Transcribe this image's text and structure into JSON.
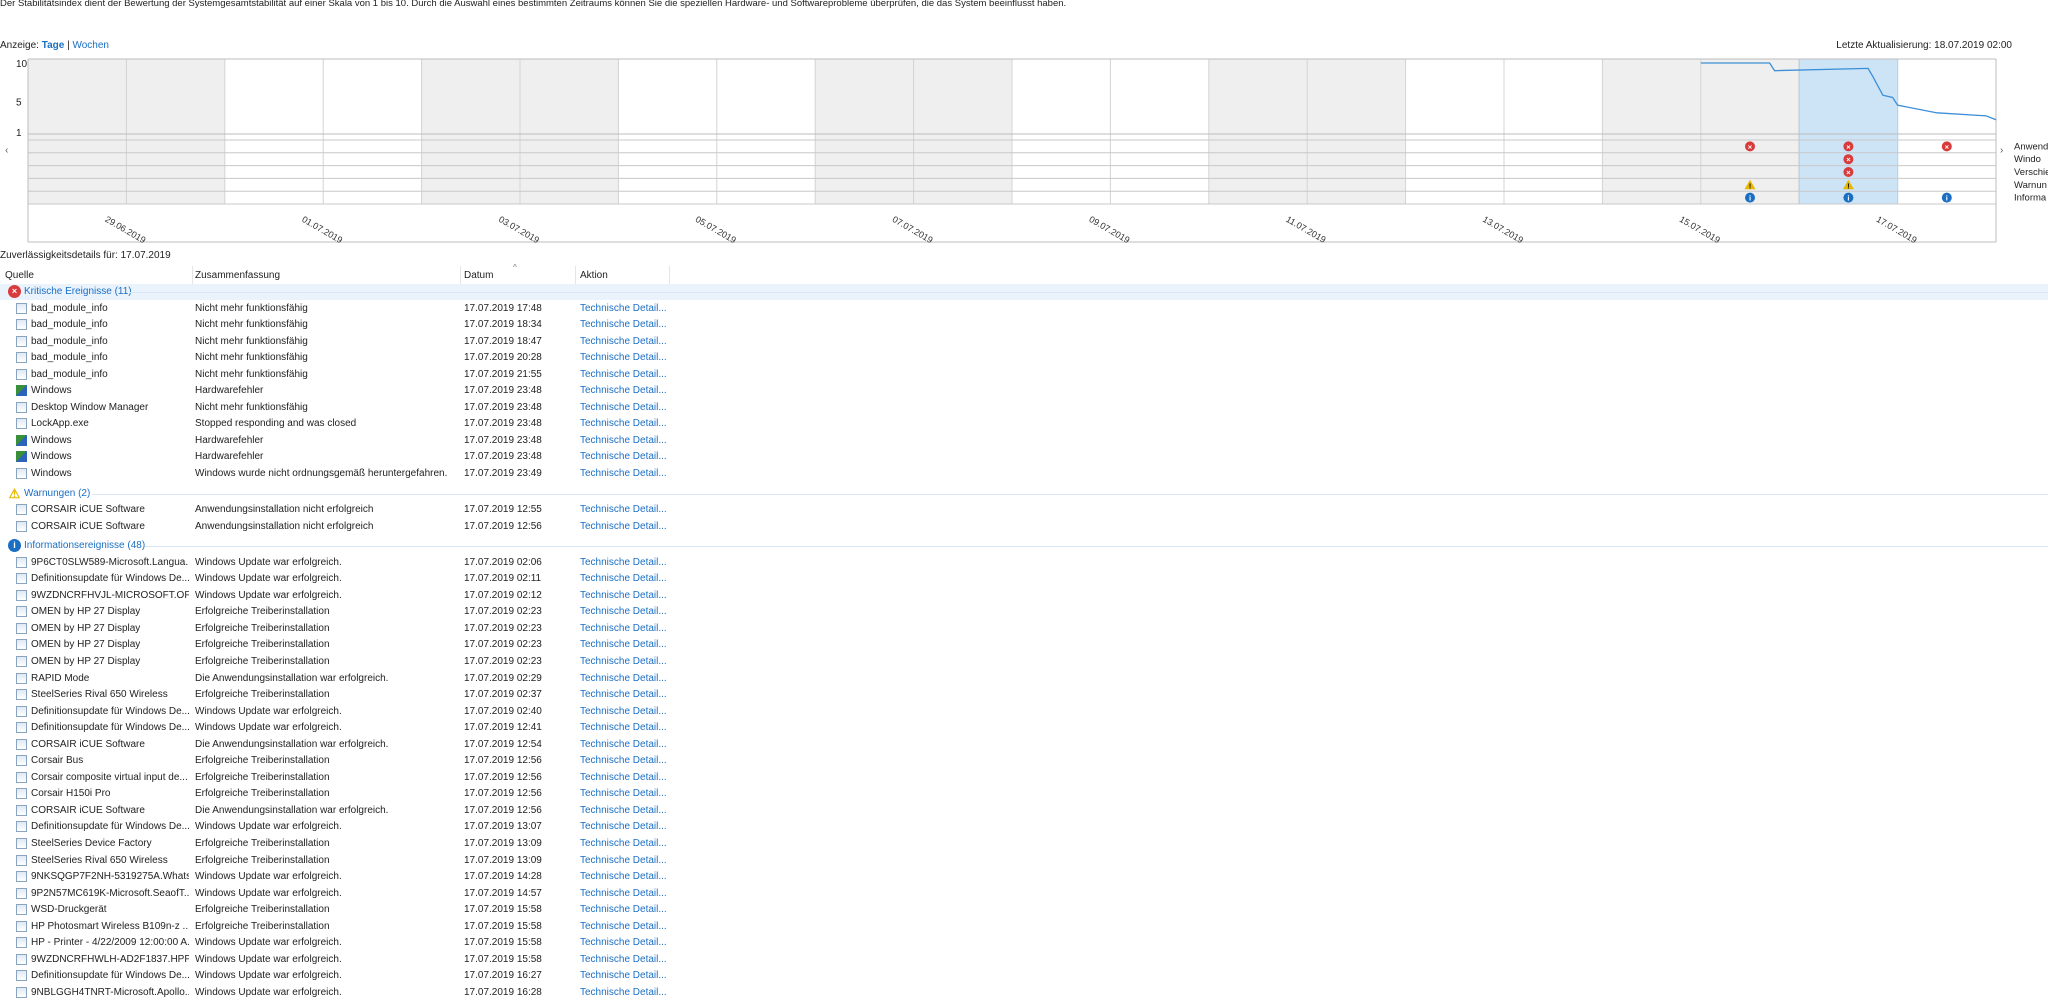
{
  "intro": "Der Stabilitätsindex dient der Bewertung der Systemgesamtstabilität auf einer Skala von 1 bis 10. Durch die Auswahl eines bestimmten Zeitraums können Sie die speziellen Hardware- und Softwareprobleme überprüfen, die das System beeinflusst haben.",
  "view": {
    "label": "Anzeige:",
    "days": "Tage",
    "sep": "|",
    "weeks": "Wochen"
  },
  "last_update": "Letzte Aktualisierung: 18.07.2019 02:00",
  "chart_data": {
    "type": "line",
    "y_ticks": [
      "10",
      "5",
      "1"
    ],
    "ylim": [
      1,
      10
    ],
    "columns": 20,
    "x_labels": [
      "29.06.2019",
      "01.07.2019",
      "03.07.2019",
      "05.07.2019",
      "07.07.2019",
      "09.07.2019",
      "11.07.2019",
      "13.07.2019",
      "15.07.2019",
      "17.07.2019"
    ],
    "selected_column": 18,
    "stability_line": [
      [
        17.0,
        10.0
      ],
      [
        17.7,
        10.0
      ],
      [
        17.75,
        9.0
      ],
      [
        18.7,
        9.3
      ],
      [
        18.75,
        8.2
      ],
      [
        18.85,
        5.8
      ],
      [
        18.95,
        5.5
      ],
      [
        19.0,
        4.5
      ],
      [
        19.4,
        3.5
      ],
      [
        19.9,
        3.1
      ],
      [
        20,
        2.6
      ]
    ],
    "rows": [
      "Anwendungsfehler",
      "Windows-Fehler",
      "Verschiedene Fehler",
      "Warnungen",
      "Informationen"
    ],
    "events": [
      {
        "row": 0,
        "col": 17,
        "kind": "error"
      },
      {
        "row": 0,
        "col": 18,
        "kind": "error"
      },
      {
        "row": 0,
        "col": 19,
        "kind": "error"
      },
      {
        "row": 1,
        "col": 18,
        "kind": "error"
      },
      {
        "row": 2,
        "col": 18,
        "kind": "error"
      },
      {
        "row": 3,
        "col": 17,
        "kind": "warn"
      },
      {
        "row": 3,
        "col": 18,
        "kind": "warn"
      },
      {
        "row": 4,
        "col": 17,
        "kind": "info"
      },
      {
        "row": 4,
        "col": 18,
        "kind": "info"
      },
      {
        "row": 4,
        "col": 19,
        "kind": "info"
      }
    ],
    "right_labels": [
      "Anwend",
      "Windo",
      "Verschie",
      "Warnun",
      "Informa"
    ]
  },
  "details_title": "Zuverlässigkeitsdetails für: 17.07.2019",
  "columns": {
    "source": "Quelle",
    "summary": "Zusammenfassung",
    "date": "Datum",
    "action": "Aktion"
  },
  "groups": [
    {
      "label": "Kritische Ereignisse (11)",
      "icon": "error",
      "rows": [
        [
          "bad_module_info",
          "Nicht mehr funktionsfähig",
          "17.07.2019 17:48",
          "Technische Detail..."
        ],
        [
          "bad_module_info",
          "Nicht mehr funktionsfähig",
          "17.07.2019 18:34",
          "Technische Detail..."
        ],
        [
          "bad_module_info",
          "Nicht mehr funktionsfähig",
          "17.07.2019 18:47",
          "Technische Detail..."
        ],
        [
          "bad_module_info",
          "Nicht mehr funktionsfähig",
          "17.07.2019 20:28",
          "Technische Detail..."
        ],
        [
          "bad_module_info",
          "Nicht mehr funktionsfähig",
          "17.07.2019 21:55",
          "Technische Detail..."
        ],
        [
          "Windows",
          "Hardwarefehler",
          "17.07.2019 23:48",
          "Technische Detail..."
        ],
        [
          "Desktop Window Manager",
          "Nicht mehr funktionsfähig",
          "17.07.2019 23:48",
          "Technische Detail..."
        ],
        [
          "LockApp.exe",
          "Stopped responding and was closed",
          "17.07.2019 23:48",
          "Technische Detail..."
        ],
        [
          "Windows",
          "Hardwarefehler",
          "17.07.2019 23:48",
          "Technische Detail..."
        ],
        [
          "Windows",
          "Hardwarefehler",
          "17.07.2019 23:48",
          "Technische Detail..."
        ],
        [
          "Windows",
          "Windows wurde nicht ordnungsgemäß heruntergefahren.",
          "17.07.2019 23:49",
          "Technische Detail..."
        ]
      ]
    },
    {
      "label": "Warnungen (2)",
      "icon": "warn",
      "rows": [
        [
          "CORSAIR iCUE Software",
          "Anwendungsinstallation nicht erfolgreich",
          "17.07.2019 12:55",
          "Technische Detail..."
        ],
        [
          "CORSAIR iCUE Software",
          "Anwendungsinstallation nicht erfolgreich",
          "17.07.2019 12:56",
          "Technische Detail..."
        ]
      ]
    },
    {
      "label": "Informationsereignisse (48)",
      "icon": "info",
      "rows": [
        [
          "9P6CT0SLW589-Microsoft.Langua...",
          "Windows Update war erfolgreich.",
          "17.07.2019 02:06",
          "Technische Detail..."
        ],
        [
          "Definitionsupdate für Windows De...",
          "Windows Update war erfolgreich.",
          "17.07.2019 02:11",
          "Technische Detail..."
        ],
        [
          "9WZDNCRFHVJL-MICROSOFT.OF...",
          "Windows Update war erfolgreich.",
          "17.07.2019 02:12",
          "Technische Detail..."
        ],
        [
          "OMEN by HP 27 Display",
          "Erfolgreiche Treiberinstallation",
          "17.07.2019 02:23",
          "Technische Detail..."
        ],
        [
          "OMEN by HP 27 Display",
          "Erfolgreiche Treiberinstallation",
          "17.07.2019 02:23",
          "Technische Detail..."
        ],
        [
          "OMEN by HP 27 Display",
          "Erfolgreiche Treiberinstallation",
          "17.07.2019 02:23",
          "Technische Detail..."
        ],
        [
          "OMEN by HP 27 Display",
          "Erfolgreiche Treiberinstallation",
          "17.07.2019 02:23",
          "Technische Detail..."
        ],
        [
          "RAPID Mode",
          "Die Anwendungsinstallation war erfolgreich.",
          "17.07.2019 02:29",
          "Technische Detail..."
        ],
        [
          "SteelSeries Rival 650 Wireless",
          "Erfolgreiche Treiberinstallation",
          "17.07.2019 02:37",
          "Technische Detail..."
        ],
        [
          "Definitionsupdate für Windows De...",
          "Windows Update war erfolgreich.",
          "17.07.2019 02:40",
          "Technische Detail..."
        ],
        [
          "Definitionsupdate für Windows De...",
          "Windows Update war erfolgreich.",
          "17.07.2019 12:41",
          "Technische Detail..."
        ],
        [
          "CORSAIR iCUE Software",
          "Die Anwendungsinstallation war erfolgreich.",
          "17.07.2019 12:54",
          "Technische Detail..."
        ],
        [
          "Corsair Bus",
          "Erfolgreiche Treiberinstallation",
          "17.07.2019 12:56",
          "Technische Detail..."
        ],
        [
          "Corsair composite virtual input de...",
          "Erfolgreiche Treiberinstallation",
          "17.07.2019 12:56",
          "Technische Detail..."
        ],
        [
          "Corsair H150i Pro",
          "Erfolgreiche Treiberinstallation",
          "17.07.2019 12:56",
          "Technische Detail..."
        ],
        [
          "CORSAIR iCUE Software",
          "Die Anwendungsinstallation war erfolgreich.",
          "17.07.2019 12:56",
          "Technische Detail..."
        ],
        [
          "Definitionsupdate für Windows De...",
          "Windows Update war erfolgreich.",
          "17.07.2019 13:07",
          "Technische Detail..."
        ],
        [
          "SteelSeries Device Factory",
          "Erfolgreiche Treiberinstallation",
          "17.07.2019 13:09",
          "Technische Detail..."
        ],
        [
          "SteelSeries Rival 650 Wireless",
          "Erfolgreiche Treiberinstallation",
          "17.07.2019 13:09",
          "Technische Detail..."
        ],
        [
          "9NKSQGP7F2NH-5319275A.Whats...",
          "Windows Update war erfolgreich.",
          "17.07.2019 14:28",
          "Technische Detail..."
        ],
        [
          "9P2N57MC619K-Microsoft.SeaofT...",
          "Windows Update war erfolgreich.",
          "17.07.2019 14:57",
          "Technische Detail..."
        ],
        [
          "WSD-Druckgerät",
          "Erfolgreiche Treiberinstallation",
          "17.07.2019 15:58",
          "Technische Detail..."
        ],
        [
          "HP Photosmart Wireless B109n-z ...",
          "Erfolgreiche Treiberinstallation",
          "17.07.2019 15:58",
          "Technische Detail..."
        ],
        [
          "HP - Printer - 4/22/2009 12:00:00 A...",
          "Windows Update war erfolgreich.",
          "17.07.2019 15:58",
          "Technische Detail..."
        ],
        [
          "9WZDNCRFHWLH-AD2F1837.HPP...",
          "Windows Update war erfolgreich.",
          "17.07.2019 15:58",
          "Technische Detail..."
        ],
        [
          "Definitionsupdate für Windows De...",
          "Windows Update war erfolgreich.",
          "17.07.2019 16:27",
          "Technische Detail..."
        ],
        [
          "9NBLGGH4TNRT-Microsoft.Apollo...",
          "Windows Update war erfolgreich.",
          "17.07.2019 16:28",
          "Technische Detail..."
        ]
      ]
    }
  ],
  "colors": {
    "error": "#d83b3b",
    "warn": "#e8b800",
    "info": "#1a6fc4",
    "link": "#1a6fc4",
    "selection": "#cde4f7",
    "line": "#3c8fd6"
  }
}
